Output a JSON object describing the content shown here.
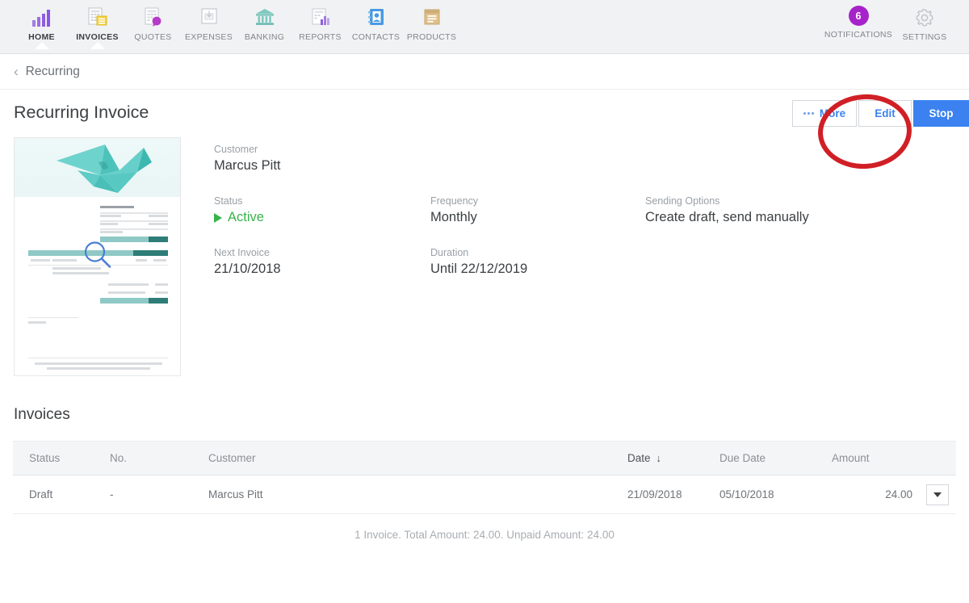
{
  "nav": {
    "items": [
      {
        "label": "HOME",
        "icon": "bar-chart-icon",
        "active": true
      },
      {
        "label": "INVOICES",
        "icon": "invoice-document-icon",
        "active": true
      },
      {
        "label": "QUOTES",
        "icon": "quote-document-icon",
        "active": false
      },
      {
        "label": "EXPENSES",
        "icon": "expense-receipt-icon",
        "active": false
      },
      {
        "label": "BANKING",
        "icon": "bank-building-icon",
        "active": false
      },
      {
        "label": "REPORTS",
        "icon": "report-chart-icon",
        "active": false
      },
      {
        "label": "CONTACTS",
        "icon": "contacts-book-icon",
        "active": false
      },
      {
        "label": "PRODUCTS",
        "icon": "products-box-icon",
        "active": false
      }
    ],
    "right": [
      {
        "label": "NOTIFICATIONS",
        "icon": "notification-badge-icon",
        "badge": "6"
      },
      {
        "label": "SETTINGS",
        "icon": "gear-icon",
        "badge": ""
      }
    ]
  },
  "breadcrumb": {
    "back_label": "Recurring",
    "arrow": "‹"
  },
  "page": {
    "title": "Recurring Invoice"
  },
  "actions": {
    "more_label": "More",
    "edit_label": "Edit",
    "stop_label": "Stop",
    "annotation_color": "#d11f26",
    "primary_color": "#3b82f0"
  },
  "details": {
    "customer": {
      "label": "Customer",
      "value": "Marcus Pitt"
    },
    "status": {
      "label": "Status",
      "value": "Active",
      "color": "#37b34a"
    },
    "frequency": {
      "label": "Frequency",
      "value": "Monthly"
    },
    "sending_options": {
      "label": "Sending Options",
      "value": "Create draft, send manually"
    },
    "next_invoice": {
      "label": "Next Invoice",
      "value": "21/10/2018"
    },
    "duration": {
      "label": "Duration",
      "value": "Until 22/12/2019"
    }
  },
  "thumbnail": {
    "name": "invoice-preview-thumbnail",
    "zoom_icon": "magnifier-icon"
  },
  "invoices": {
    "section_title": "Invoices",
    "columns": [
      {
        "key": "status",
        "label": "Status",
        "sorted": false
      },
      {
        "key": "no",
        "label": "No.",
        "sorted": false
      },
      {
        "key": "customer",
        "label": "Customer",
        "sorted": false
      },
      {
        "key": "date",
        "label": "Date",
        "sorted": true,
        "sort_arrow": "↓"
      },
      {
        "key": "due_date",
        "label": "Due Date",
        "sorted": false
      },
      {
        "key": "amount",
        "label": "Amount",
        "sorted": false
      }
    ],
    "rows": [
      {
        "status": "Draft",
        "no": "-",
        "customer": "Marcus Pitt",
        "date": "21/09/2018",
        "due_date": "05/10/2018",
        "amount": "24.00"
      }
    ],
    "summary": "1 Invoice. Total Amount: 24.00. Unpaid Amount: 24.00"
  }
}
